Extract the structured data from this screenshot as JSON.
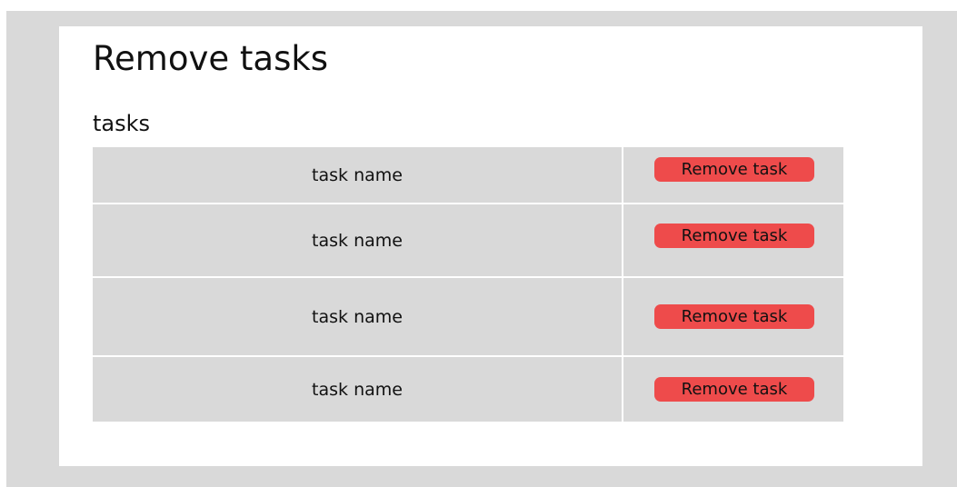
{
  "page": {
    "title": "Remove tasks",
    "section_title": "tasks"
  },
  "tasks": [
    {
      "name": "task name",
      "remove_label": "Remove task"
    },
    {
      "name": "task name",
      "remove_label": "Remove task"
    },
    {
      "name": "task name",
      "remove_label": "Remove task"
    },
    {
      "name": "task name",
      "remove_label": "Remove task"
    }
  ],
  "colors": {
    "background": "#d9d9d9",
    "card": "#ffffff",
    "row": "#d9d9d9",
    "remove_button": "#ee4b4b"
  }
}
